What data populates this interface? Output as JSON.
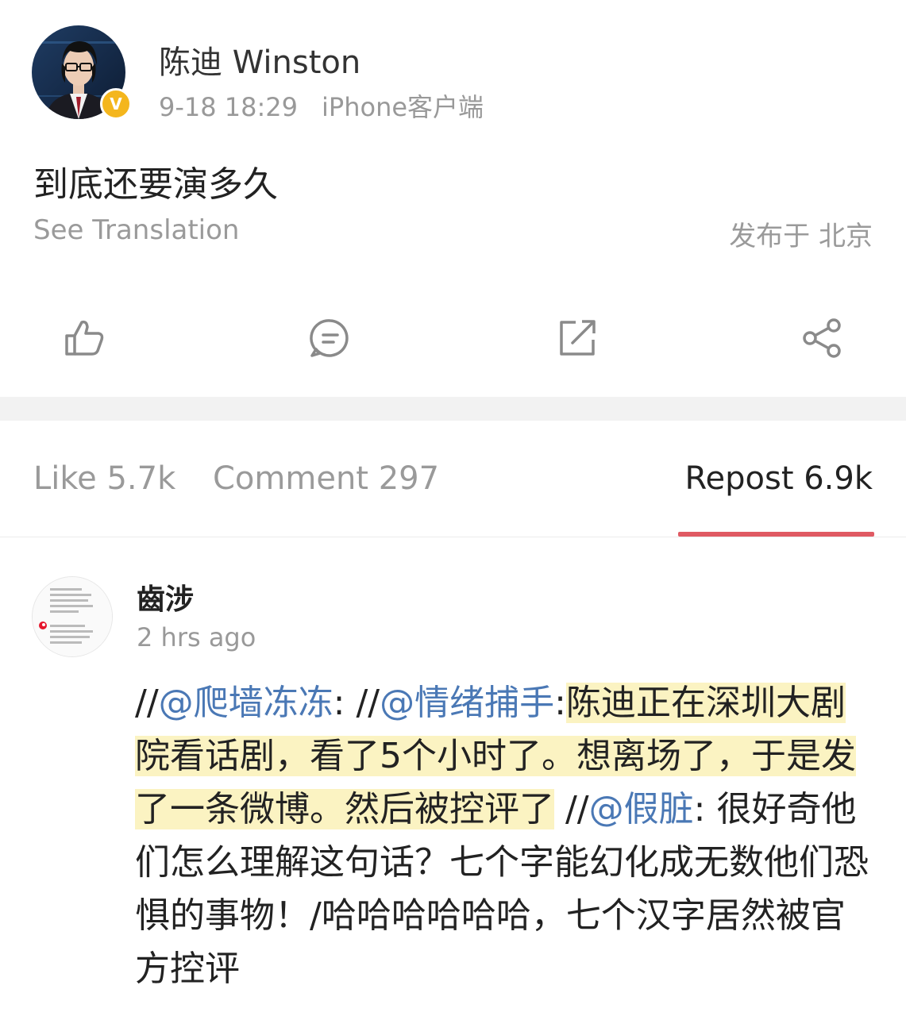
{
  "post": {
    "author": "陈迪 Winston",
    "date": "9-18 18:29",
    "device": "iPhone客户端",
    "verified_mark": "V",
    "content": "到底还要演多久",
    "see_translation": "See Translation",
    "location": "发布于 北京"
  },
  "actions": {
    "icons": [
      "thumbs-up-icon",
      "comment-icon",
      "repost-icon",
      "share-icon"
    ]
  },
  "tabs": {
    "like": "Like 5.7k",
    "comment": "Comment 297",
    "repost": "Repost 6.9k",
    "active": "repost"
  },
  "repost_item": {
    "username": "齒涉",
    "time": "2 hrs ago",
    "text_parts": {
      "p1": "//",
      "m1": "@爬墙冻冻",
      "p2": ": //",
      "m2": "@情绪捕手",
      "p3": ":",
      "h1": "陈迪正在深圳大剧院看话剧，看了5个小时了。想离场了，于是发了一条微博。然后被控评了",
      "p4": " //",
      "m3": "@假脏",
      "p5": ": 很好奇他们怎么理解这句话？七个字能幻化成无数他们恐惧的事物！/哈哈哈哈哈哈，七个汉字居然被官方控评"
    }
  },
  "colors": {
    "accent_underline": "#e05a63",
    "mention": "#4a78b5",
    "highlight": "#fbf3c2",
    "verified": "#f4b61d"
  }
}
